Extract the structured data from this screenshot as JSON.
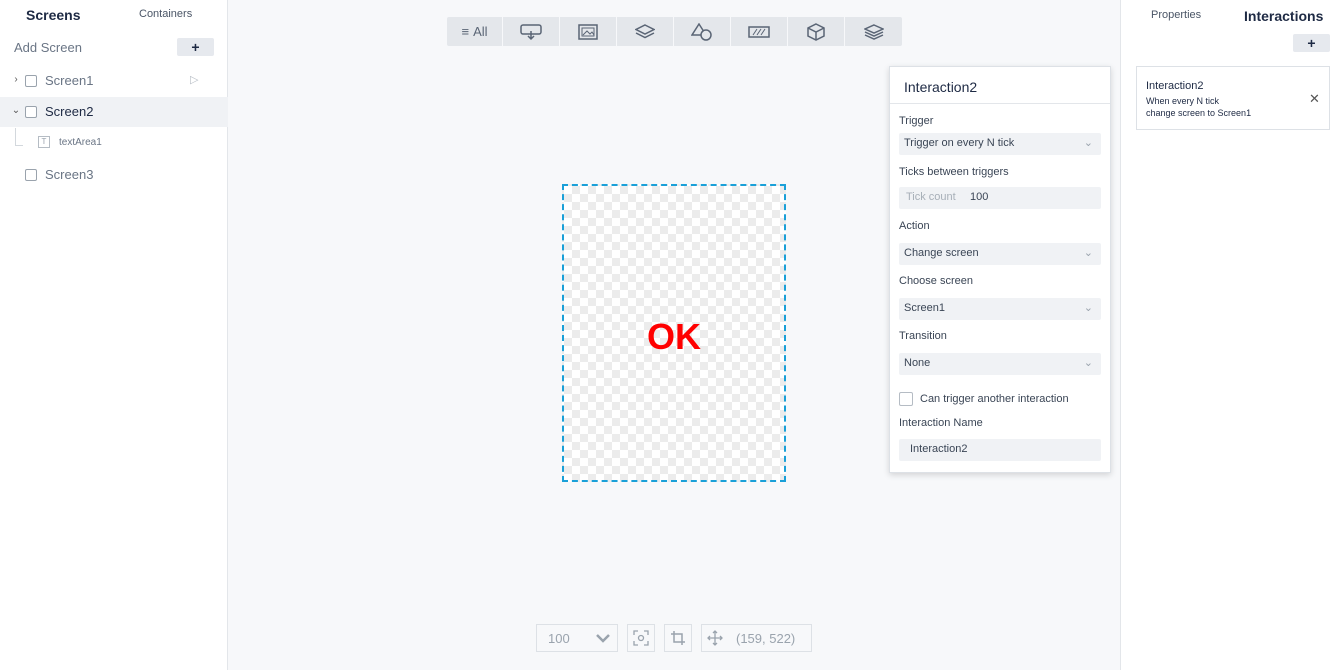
{
  "left_panel": {
    "tabs": {
      "screens": "Screens",
      "containers": "Containers"
    },
    "add_screen_label": "Add Screen",
    "add_button": "+",
    "screens": [
      {
        "label": "Screen1",
        "expanded": false,
        "selected": false,
        "chevron": "›",
        "play_icon": "▷"
      },
      {
        "label": "Screen2",
        "expanded": true,
        "selected": true,
        "chevron": "⌄"
      },
      {
        "label": "Screen3"
      }
    ],
    "screen2_children": [
      {
        "label": "textArea1",
        "icon": "text-icon"
      }
    ]
  },
  "toolbar": {
    "all_label": "All",
    "icons": [
      "interaction-icon",
      "image-icon",
      "layers-icon",
      "shapes-icon",
      "progress-icon",
      "box-3d-icon",
      "layer-stack-icon"
    ]
  },
  "canvas": {
    "text": "OK",
    "text_color": "#ff0000",
    "frame_color": "#1aa0d8"
  },
  "bottom_bar": {
    "zoom": "100",
    "coords": "(159, 522)"
  },
  "popup": {
    "title": "Interaction2",
    "trigger_label": "Trigger",
    "trigger_value": "Trigger on every N tick",
    "ticks_label": "Ticks between triggers",
    "tick_count_placeholder": "Tick count",
    "tick_count_value": "100",
    "action_label": "Action",
    "action_value": "Change screen",
    "choose_screen_label": "Choose screen",
    "choose_screen_value": "Screen1",
    "transition_label": "Transition",
    "transition_value": "None",
    "can_trigger_label": "Can trigger another interaction",
    "can_trigger_checked": false,
    "name_label": "Interaction Name",
    "name_value": "Interaction2"
  },
  "right_panel": {
    "tabs": {
      "properties": "Properties",
      "interactions": "Interactions"
    },
    "add_button": "+",
    "interactions": [
      {
        "title": "Interaction2",
        "desc_line1": "When every N tick",
        "desc_line2": "change screen to Screen1"
      }
    ]
  }
}
